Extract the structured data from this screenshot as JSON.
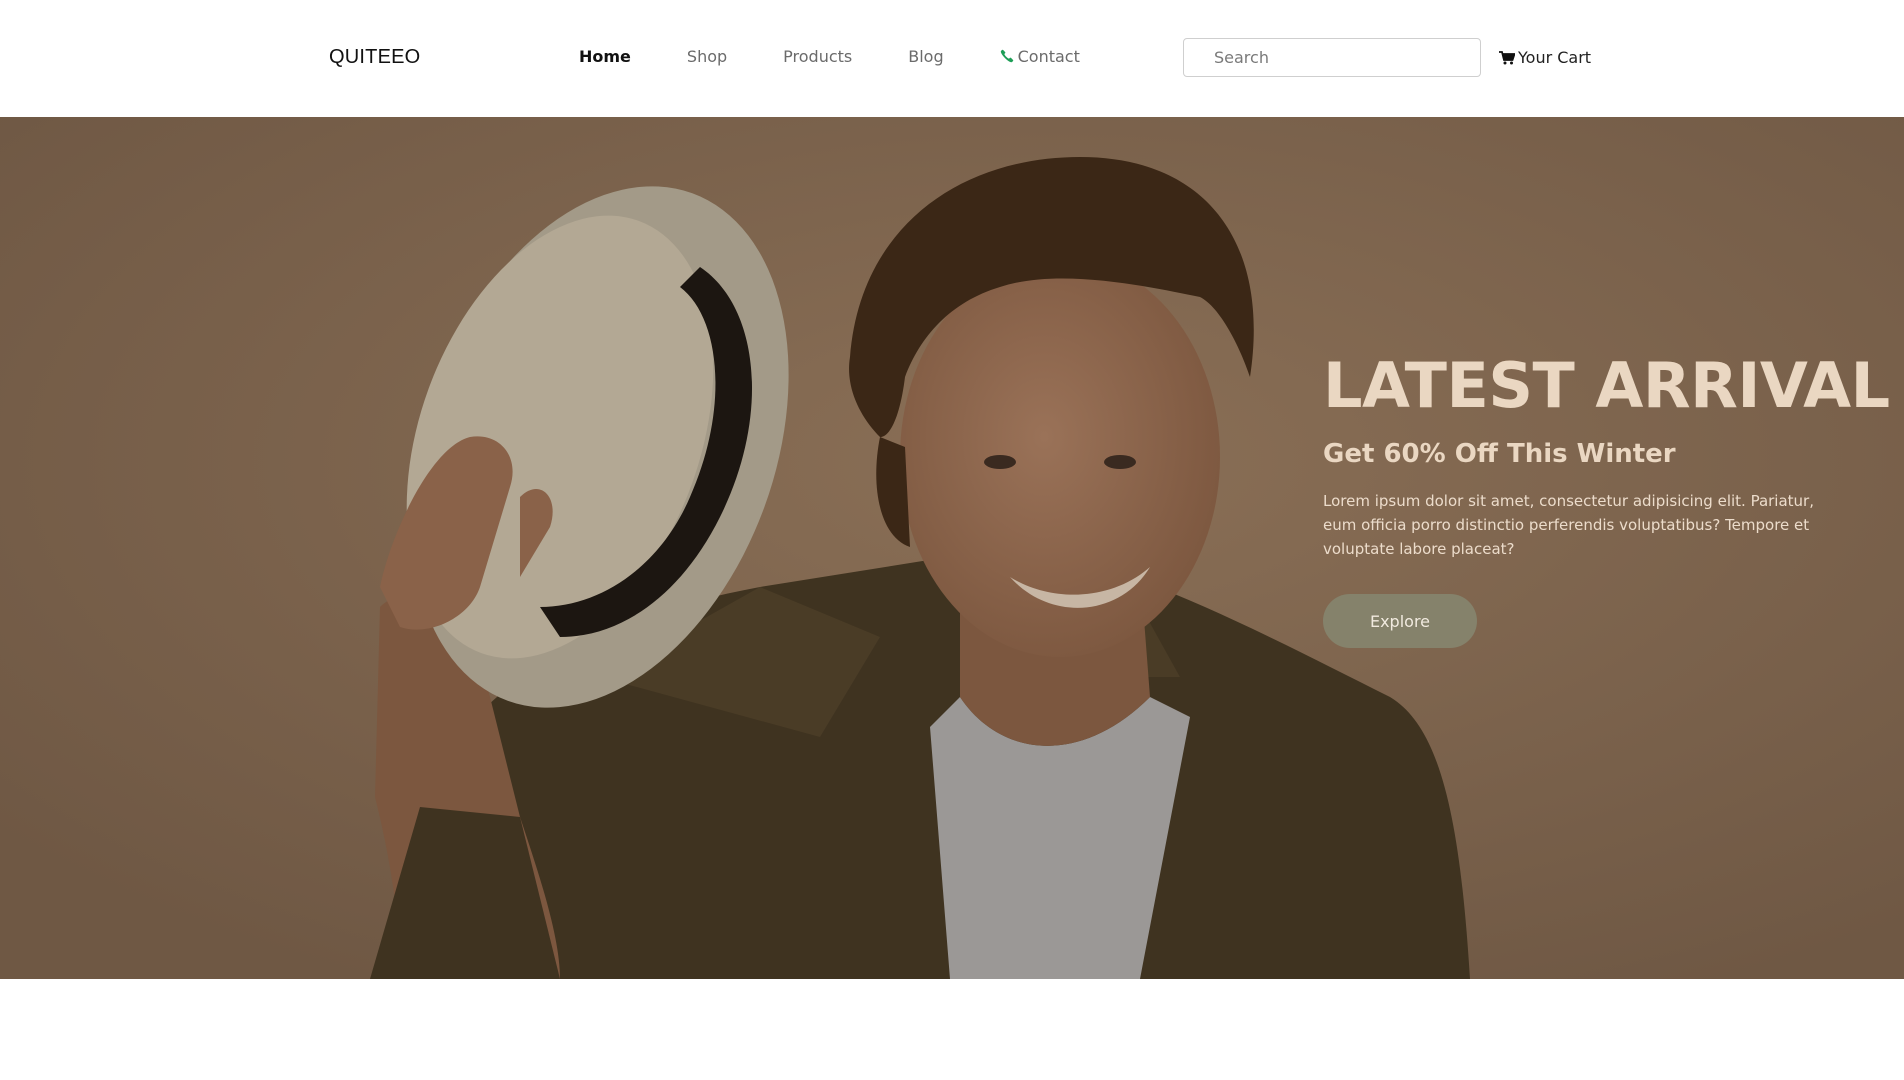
{
  "nav": {
    "brand": "QUITEEO",
    "links": [
      {
        "label": "Home",
        "active": true
      },
      {
        "label": "Shop",
        "active": false
      },
      {
        "label": "Products",
        "active": false
      },
      {
        "label": "Blog",
        "active": false
      },
      {
        "label": "Contact",
        "active": false,
        "icon": "phone-icon"
      }
    ],
    "search": {
      "placeholder": "Search",
      "value": ""
    },
    "cart": {
      "label": "Your Cart",
      "icon": "cart-icon"
    }
  },
  "hero": {
    "title": "LATEST ARRIVAL",
    "subtitle": "Get 60% Off This Winter",
    "text": "Lorem ipsum dolor sit amet, consectetur adipisicing elit. Pariatur, eum officia porro distinctio perferendis voluptatibus? Tempore et voluptate labore placeat?",
    "button": "Explore",
    "image": "man-holding-hat-photo"
  },
  "colors": {
    "accent_green": "#1e9e57",
    "hero_overlay": "#7a624b",
    "hero_heading": "#ead7c2",
    "button_bg": "#85826b"
  }
}
